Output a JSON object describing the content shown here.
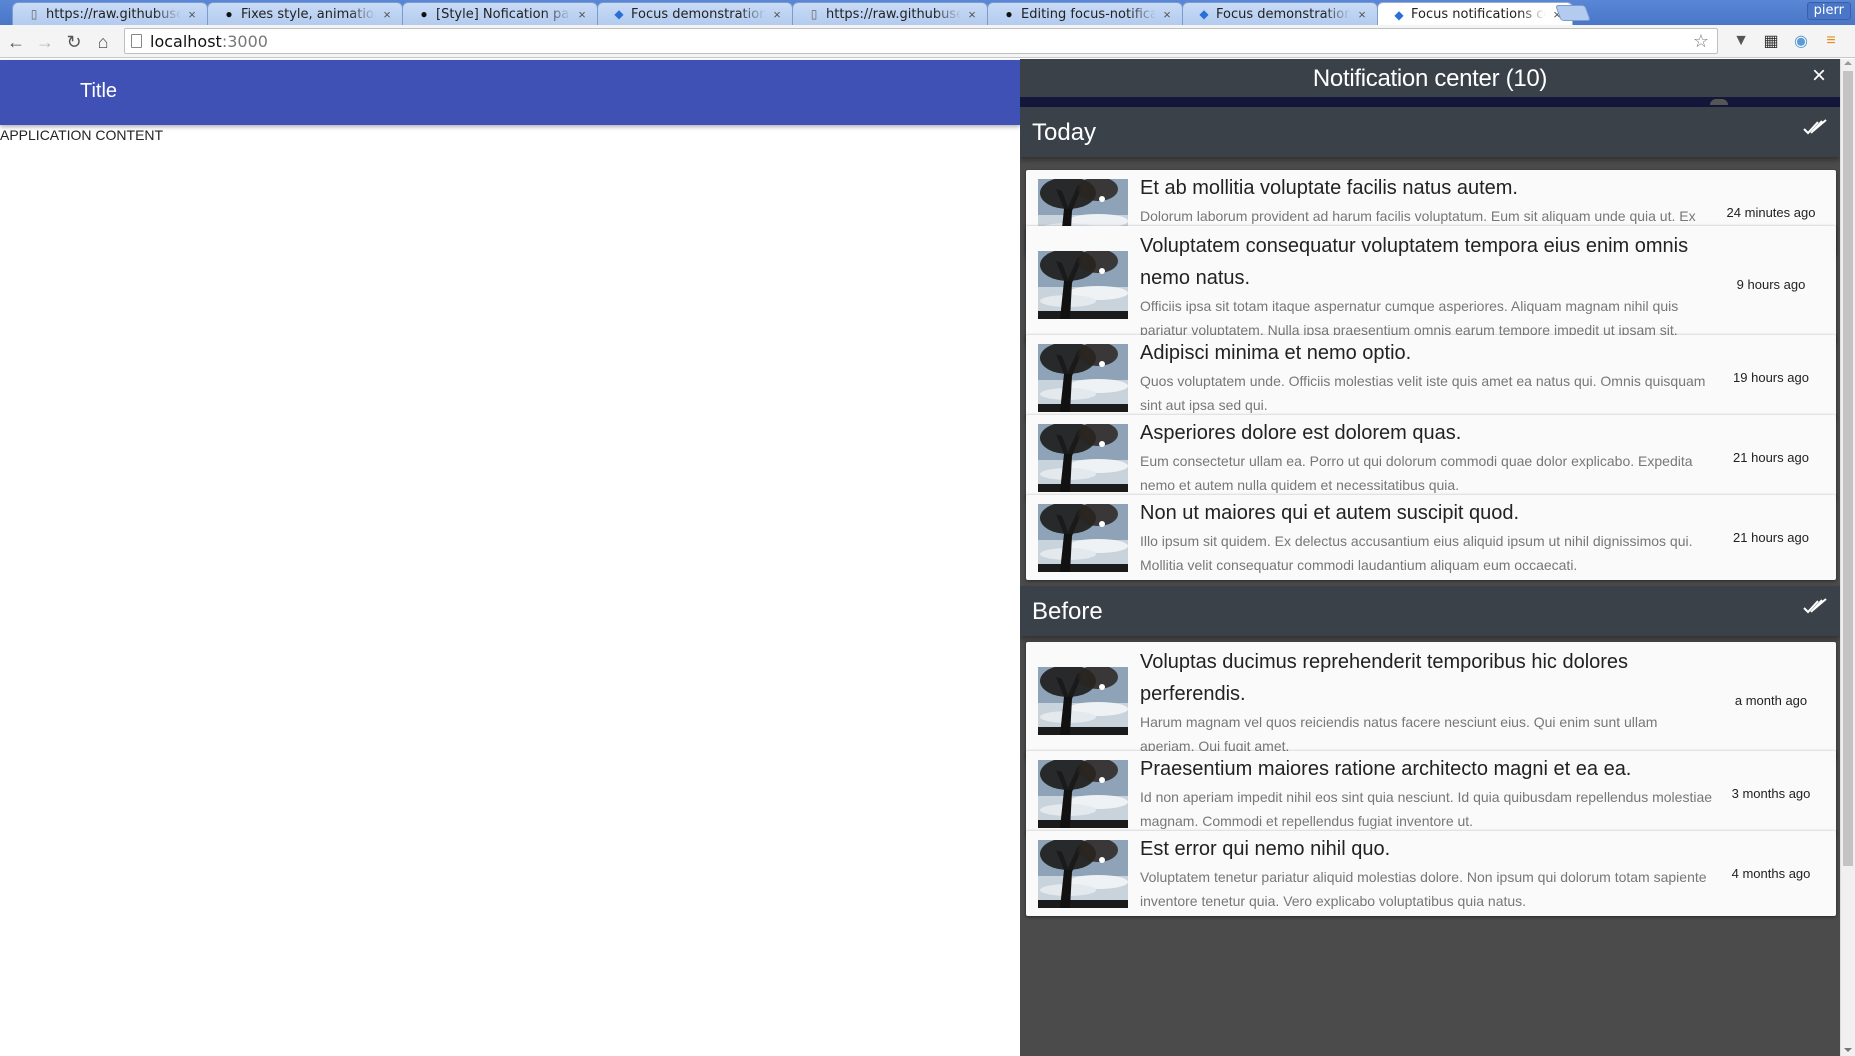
{
  "browser": {
    "tabs": [
      {
        "icon": "page-icon",
        "title": "https://raw.githubusercontent.com",
        "active": false
      },
      {
        "icon": "github-icon",
        "title": "Fixes style, animations",
        "active": false
      },
      {
        "icon": "github-icon",
        "title": "[Style] Nofication panel",
        "active": false
      },
      {
        "icon": "app-icon",
        "title": "Focus demonstration",
        "active": false
      },
      {
        "icon": "page-icon",
        "title": "https://raw.githubusercontent.com",
        "active": false
      },
      {
        "icon": "github-icon",
        "title": "Editing focus-notifications",
        "active": false
      },
      {
        "icon": "app-icon",
        "title": "Focus demonstration",
        "active": false
      },
      {
        "icon": "app-icon",
        "title": "Focus notifications center",
        "active": true
      }
    ],
    "tab_close_glyph": "×",
    "profile_name": "pierr",
    "address": {
      "host": "localhost",
      "port": ":3000"
    },
    "nav": {
      "back": "←",
      "forward": "→",
      "reload": "↻",
      "home": "⌂"
    },
    "star": "☆",
    "extensions": [
      {
        "name": "pocket-icon",
        "glyph": "▼",
        "color": "#555555"
      },
      {
        "name": "film-icon",
        "glyph": "▦",
        "color": "#333333"
      },
      {
        "name": "camera-icon",
        "glyph": "◉",
        "color": "#5b9bd5"
      },
      {
        "name": "menu-icon",
        "glyph": "≡",
        "color": "#e8891a"
      }
    ]
  },
  "app": {
    "title": "Title",
    "content": "APPLICATION CONTENT",
    "accent": "#3f51b5"
  },
  "notification_center": {
    "title": "Notification center (10)",
    "close_glyph": "×",
    "sections": [
      {
        "label": "Today",
        "items": [
          {
            "title": "Et ab mollitia voluptate facilis natus autem.",
            "text": "Dolorum laborum provident ad harum facilis voluptatum. Eum sit aliquam unde quia ut. Ex omnis similique molestiae at nostrum assumenda.",
            "time": "24 minutes ago"
          },
          {
            "title": "Voluptatem consequatur voluptatem tempora eius enim omnis nemo natus.",
            "text": "Officiis ipsa sit totam itaque aspernatur cumque asperiores. Aliquam magnam nihil quis pariatur voluptatem. Nulla ipsa praesentium omnis earum tempore impedit ut ipsam sit.",
            "time": "9 hours ago"
          },
          {
            "title": "Adipisci minima et nemo optio.",
            "text": "Quos voluptatem unde. Officiis molestias velit iste quis amet ea natus qui. Omnis quisquam sint aut ipsa sed qui.",
            "time": "19 hours ago"
          },
          {
            "title": "Asperiores dolore est dolorem quas.",
            "text": "Eum consectetur ullam ea. Porro ut qui dolorum commodi quae dolor explicabo. Expedita nemo et autem nulla quidem et necessitatibus quia.",
            "time": "21 hours ago"
          },
          {
            "title": "Non ut maiores qui et autem suscipit quod.",
            "text": "Illo ipsum sit quidem. Ex delectus accusantium eius aliquid ipsum ut nihil dignissimos qui. Mollitia velit consequatur commodi laudantium aliquam eum occaecati.",
            "time": "21 hours ago"
          }
        ]
      },
      {
        "label": "Before",
        "items": [
          {
            "title": "Voluptas ducimus reprehenderit temporibus hic dolores perferendis.",
            "text": "Harum magnam vel quos reiciendis natus facere nesciunt eius. Qui enim sunt ullam aperiam. Qui fugit amet.",
            "time": "a month ago"
          },
          {
            "title": "Praesentium maiores ratione architecto magni et ea ea.",
            "text": "Id non aperiam impedit nihil eos sint quia nesciunt. Id quia quibusdam repellendus molestiae magnam. Commodi et repellendus fugiat inventore ut.",
            "time": "3 months ago"
          },
          {
            "title": "Est error qui nemo nihil quo.",
            "text": "Voluptatem tenetur pariatur aliquid molestias dolore. Non ipsum qui dolorum totam sapiente inventore tenetur quia. Vero explicabo voluptatibus quia natus.",
            "time": "4 months ago"
          }
        ]
      }
    ],
    "colors": {
      "header": "#3a4149",
      "strip": "#13173a",
      "panel_bg": "#4b4b4b",
      "card_bg": "#fafafa"
    }
  }
}
